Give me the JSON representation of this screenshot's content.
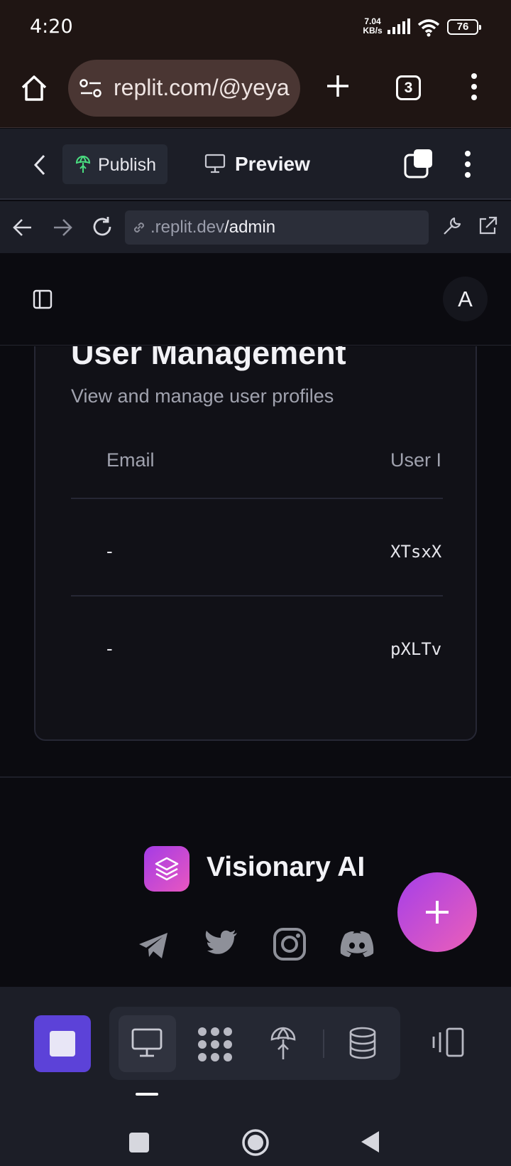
{
  "status_bar": {
    "time": "4:20",
    "network_speed_value": "7.04",
    "network_speed_unit": "KB/s",
    "battery": "76"
  },
  "browser": {
    "url": "replit.com/@yeya",
    "tab_count": "3"
  },
  "replit_header": {
    "publish_label": "Publish",
    "preview_label": "Preview"
  },
  "preview_nav": {
    "address_domain": ".replit.dev",
    "address_path": "/admin"
  },
  "app": {
    "avatar_initial": "A",
    "card": {
      "title": "User Management",
      "subtitle": "View and manage user profiles",
      "columns": [
        "Email",
        "User I"
      ],
      "rows": [
        {
          "email": "-",
          "user_id": "XTsxXu"
        },
        {
          "email": "-",
          "user_id": "pXLTv"
        }
      ]
    },
    "footer": {
      "brand_name": "Visionary AI",
      "social_icons": [
        "telegram-icon",
        "twitter-icon",
        "instagram-icon",
        "discord-icon"
      ]
    }
  },
  "colors": {
    "accent_purple": "#5c42d8",
    "brand_gradient_start": "#a43be6",
    "brand_gradient_end": "#e857c0",
    "publish_icon_green": "#4ade80"
  }
}
